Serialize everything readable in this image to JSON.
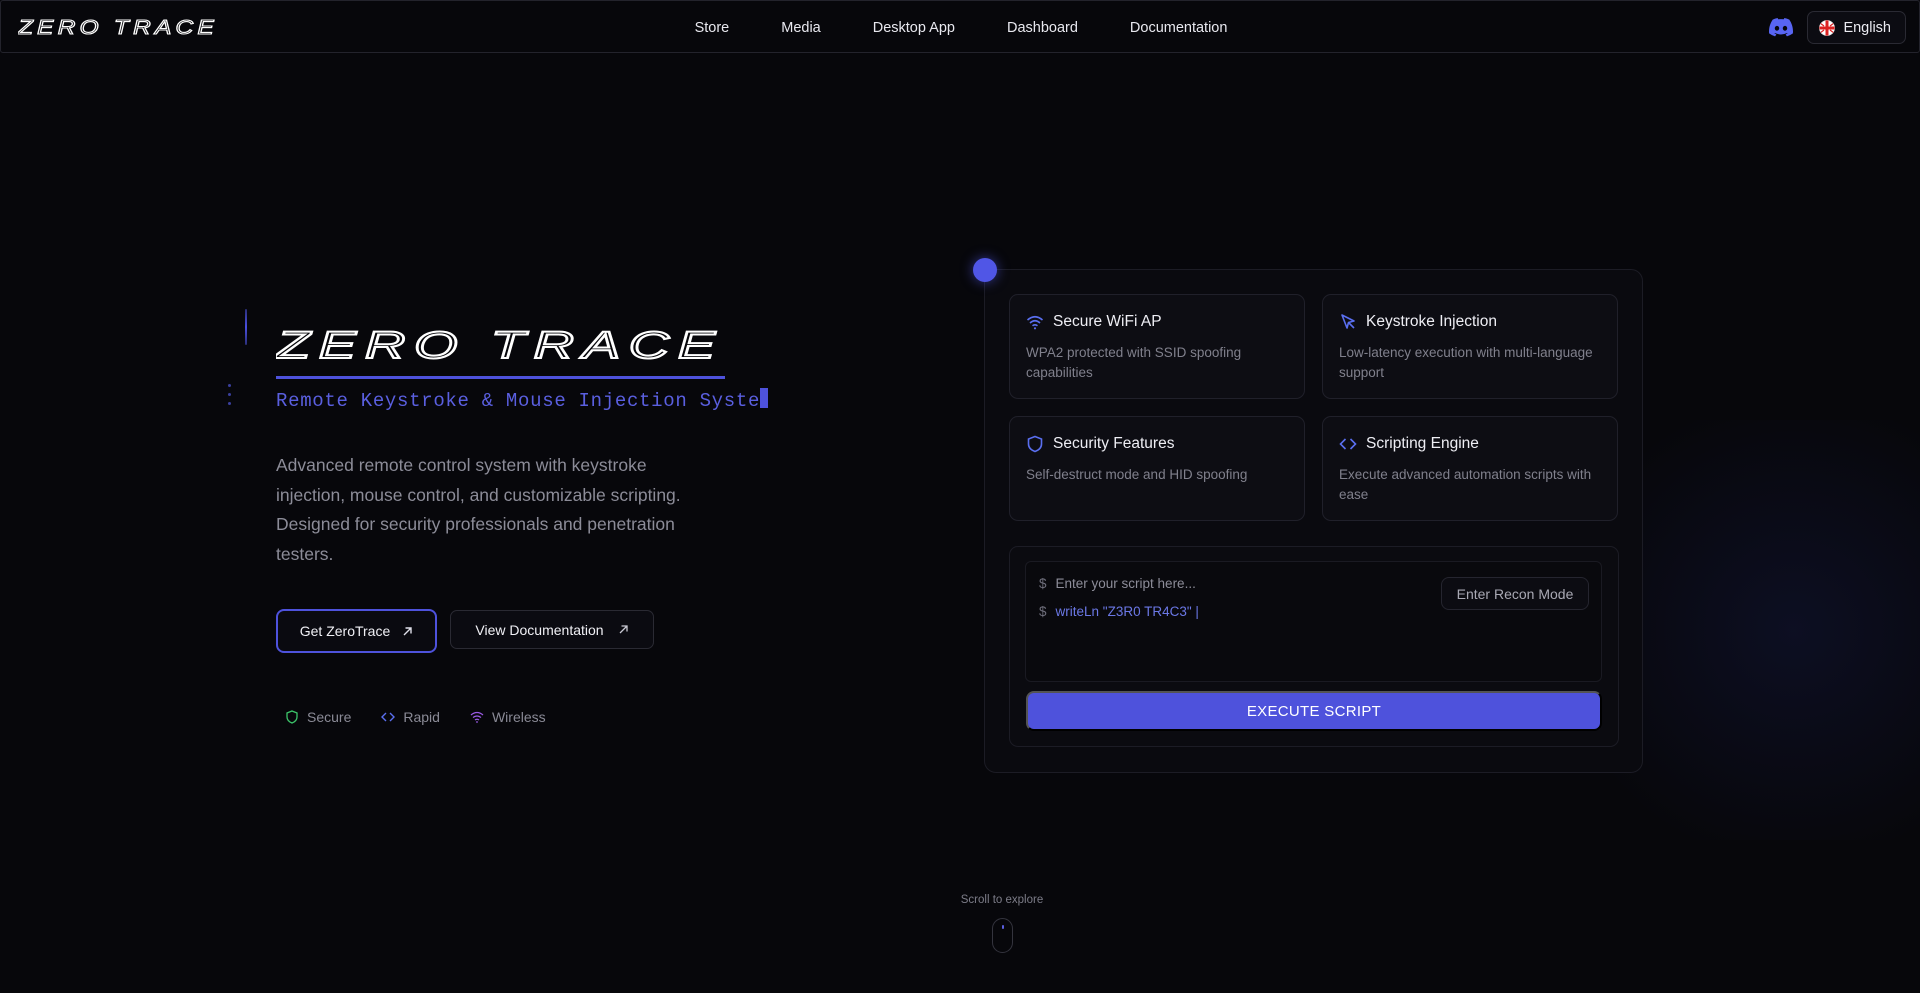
{
  "nav": {
    "logo": "ZERO TRACE",
    "links": [
      "Store",
      "Media",
      "Desktop App",
      "Dashboard",
      "Documentation"
    ],
    "discord_icon": "discord-icon",
    "language": "English",
    "flag_icon": "uk-flag-icon"
  },
  "hero": {
    "logo": "ZERO TRACE",
    "subtitle": "Remote Keystroke & Mouse Injection Syste",
    "description": "Advanced remote control system with keystroke injection, mouse control, and customizable scripting. Designed for security professionals and penetration testers.",
    "primary_button": "Get ZeroTrace",
    "secondary_button": "View Documentation",
    "tags": [
      {
        "label": "Secure",
        "icon": "shield-icon",
        "color": "#3cc46a"
      },
      {
        "label": "Rapid",
        "icon": "code-icon",
        "color": "#5a6ff0"
      },
      {
        "label": "Wireless",
        "icon": "wifi-icon",
        "color": "#9a5ae6"
      }
    ]
  },
  "features": [
    {
      "title": "Secure WiFi AP",
      "desc": "WPA2 protected with SSID spoofing capabilities",
      "icon": "wifi-icon"
    },
    {
      "title": "Keystroke Injection",
      "desc": "Low-latency execution with multi-language support",
      "icon": "cursor-icon"
    },
    {
      "title": "Security Features",
      "desc": "Self-destruct mode and HID spoofing",
      "icon": "shield-icon"
    },
    {
      "title": "Scripting Engine",
      "desc": "Execute advanced automation scripts with ease",
      "icon": "code-icon"
    }
  ],
  "terminal": {
    "prompt": "$",
    "placeholder": "Enter your script here...",
    "code": "writeLn \"Z3R0 TR4C3\" |",
    "recon_button": "Enter Recon Mode",
    "execute_button": "EXECUTE SCRIPT"
  },
  "scroll_hint": "Scroll to explore",
  "colors": {
    "accent": "#4e52dc",
    "background": "#07070b"
  }
}
